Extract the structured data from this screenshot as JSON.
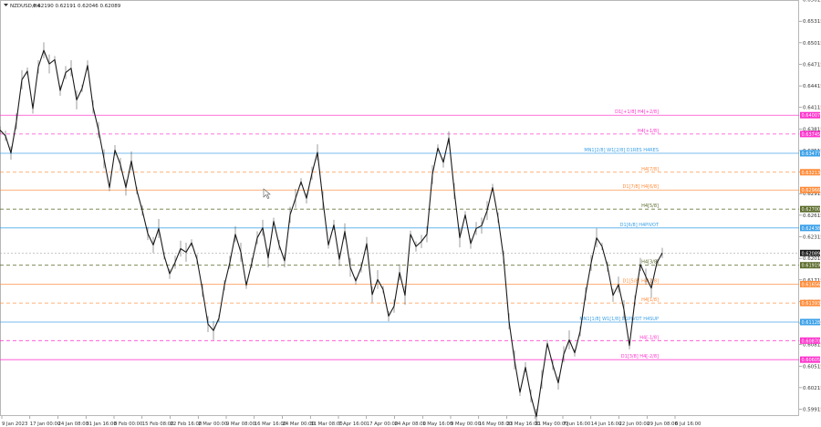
{
  "header": {
    "symbol": "NZDUSD,H4",
    "ohlc": "0.62190 0.62191 0.62046 0.62089"
  },
  "colors": {
    "price_line": "#1a1a1a",
    "grid": "#d9d9d9",
    "pink": "#ff33cc",
    "orange": "#ff8c3a",
    "blue": "#3aa0e8",
    "olive": "#5a6b2a",
    "gray_dash": "#aaaaaa",
    "current_box": "#1a1a1a"
  },
  "chart_data": {
    "type": "line",
    "y_axis": {
      "min": 0.5982,
      "max": 0.6561,
      "ticks": [
        "0.65615",
        "0.65315",
        "0.65015",
        "0.64715",
        "0.64415",
        "0.64115",
        "0.63815",
        "0.63515",
        "0.63215",
        "0.62915",
        "0.62615",
        "0.62315",
        "0.62015",
        "0.61715",
        "0.61415",
        "0.61115",
        "0.60815",
        "0.60515",
        "0.60215",
        "0.59915"
      ]
    },
    "x_axis": {
      "ticks": [
        "9 Jan 2023",
        "17 Jan 00:00",
        "24 Jan 08:00",
        "31 Jan 16:00",
        "8 Feb 00:00",
        "15 Feb 08:00",
        "22 Feb 16:00",
        "2 Mar 00:00",
        "9 Mar 08:00",
        "16 Mar 16:00",
        "24 Mar 00:00",
        "31 Mar 08:00",
        "7 Apr 16:00",
        "17 Apr 00:00",
        "24 Apr 08:00",
        "1 May 16:00",
        "9 May 00:00",
        "16 May 08:00",
        "23 May 16:00",
        "31 May 00:00",
        "7 Jun 16:00",
        "14 Jun 16:00",
        "22 Jun 00:00",
        "29 Jun 08:00",
        "6 Jul 16:00"
      ]
    },
    "series": [
      {
        "x": [
          0,
          6,
          12,
          18,
          24,
          30,
          36,
          42,
          48,
          54,
          60,
          66,
          72,
          78,
          84,
          90,
          96,
          102,
          108,
          114,
          120,
          126,
          132,
          138,
          144,
          150,
          156,
          162,
          168,
          174,
          180,
          186,
          192,
          198,
          204,
          210,
          216,
          222,
          228,
          234,
          240,
          246,
          252,
          258,
          264,
          270,
          276,
          282,
          288,
          294,
          300,
          306,
          312,
          318,
          324,
          330,
          336,
          342,
          348,
          354,
          360,
          366,
          372,
          378,
          384,
          390,
          396,
          402,
          408,
          414,
          420,
          426,
          432,
          438,
          444,
          450,
          456,
          462,
          468,
          474,
          480,
          486,
          492,
          498,
          504,
          510,
          516,
          522,
          528,
          534,
          540,
          546,
          552,
          558,
          564,
          570,
          576,
          582,
          588,
          594,
          600,
          606,
          612,
          618,
          624,
          630,
          636,
          642,
          648,
          654,
          660,
          666,
          672,
          678,
          684,
          690,
          696,
          702,
          708,
          714,
          720,
          726
        ],
        "y": [
          0.638,
          0.6372,
          0.6348,
          0.6392,
          0.645,
          0.6462,
          0.641,
          0.6468,
          0.6491,
          0.6472,
          0.6478,
          0.6435,
          0.646,
          0.6466,
          0.6422,
          0.6438,
          0.647,
          0.6412,
          0.638,
          0.634,
          0.63,
          0.6352,
          0.6332,
          0.63,
          0.6337,
          0.6296,
          0.6268,
          0.6236,
          0.622,
          0.6243,
          0.6205,
          0.618,
          0.6196,
          0.6215,
          0.621,
          0.6223,
          0.62,
          0.6157,
          0.611,
          0.6101,
          0.6118,
          0.6164,
          0.6196,
          0.6235,
          0.621,
          0.6164,
          0.6195,
          0.623,
          0.6244,
          0.6202,
          0.6253,
          0.622,
          0.6198,
          0.6262,
          0.6285,
          0.6308,
          0.6285,
          0.632,
          0.6349,
          0.6282,
          0.622,
          0.6248,
          0.62,
          0.6239,
          0.6189,
          0.617,
          0.6189,
          0.6222,
          0.6151,
          0.6172,
          0.6158,
          0.6121,
          0.6135,
          0.6182,
          0.615,
          0.6235,
          0.6218,
          0.6225,
          0.6235,
          0.6318,
          0.6355,
          0.6335,
          0.6369,
          0.6295,
          0.623,
          0.6262,
          0.6222,
          0.6243,
          0.6247,
          0.6268,
          0.63,
          0.6258,
          0.6203,
          0.6114,
          0.606,
          0.6015,
          0.605,
          0.601,
          0.5981,
          0.6033,
          0.6083,
          0.6053,
          0.6028,
          0.6068,
          0.6088,
          0.607,
          0.61,
          0.6152,
          0.6195,
          0.623,
          0.6218,
          0.619,
          0.615,
          0.6165,
          0.613,
          0.608,
          0.6143,
          0.6193,
          0.6176,
          0.616,
          0.6195,
          0.6209
        ]
      }
    ],
    "levels": [
      {
        "label": "D1[+1/8] H4[+2/8]",
        "value": 0.64007,
        "tag": "0.64007",
        "color": "pink",
        "style": "solid"
      },
      {
        "label": "H4[+1/8]",
        "value": 0.63745,
        "tag": "0.63745",
        "color": "pink",
        "style": "dash"
      },
      {
        "label": "MN1[2/8] W1[2/8] D1RES H4RES",
        "value": 0.63477,
        "tag": "0.63477",
        "color": "blue",
        "style": "solid"
      },
      {
        "label": "H4[7/8]",
        "value": 0.63213,
        "tag": "0.63213",
        "color": "orange",
        "style": "dash"
      },
      {
        "label": "D1[7/8] H4[6/8]",
        "value": 0.62966,
        "tag": "0.62966",
        "color": "orange",
        "style": "solid"
      },
      {
        "label": "H4[5/8]",
        "value": 0.627,
        "tag": "0.62700",
        "color": "olive",
        "style": "dash"
      },
      {
        "label": "D1[6/8] H4PIVOT",
        "value": 0.62438,
        "tag": "0.62438",
        "color": "blue",
        "style": "solid"
      },
      {
        "label": "H4[3/8]",
        "value": 0.61919,
        "tag": "0.61919",
        "color": "olive",
        "style": "dash"
      },
      {
        "label": "D1[5/8] H4[2/8]",
        "value": 0.61656,
        "tag": "0.61656",
        "color": "orange",
        "style": "solid"
      },
      {
        "label": "H4[1/8]",
        "value": 0.61393,
        "tag": "0.61393",
        "color": "orange",
        "style": "dash"
      },
      {
        "label": "MN1[1/8] W1[1/8] D1PIVOT H4SUP",
        "value": 0.61128,
        "tag": "0.61128",
        "color": "blue",
        "style": "solid"
      },
      {
        "label": "H4[-1/8]",
        "value": 0.6087,
        "tag": "0.60870",
        "color": "pink",
        "style": "dash"
      },
      {
        "label": "D1[3/8] H4[-2/8]",
        "value": 0.60605,
        "tag": "0.60605",
        "color": "pink",
        "style": "solid"
      }
    ],
    "current_price": {
      "value": 0.62089,
      "tag": "0.62089"
    },
    "grid": false
  }
}
